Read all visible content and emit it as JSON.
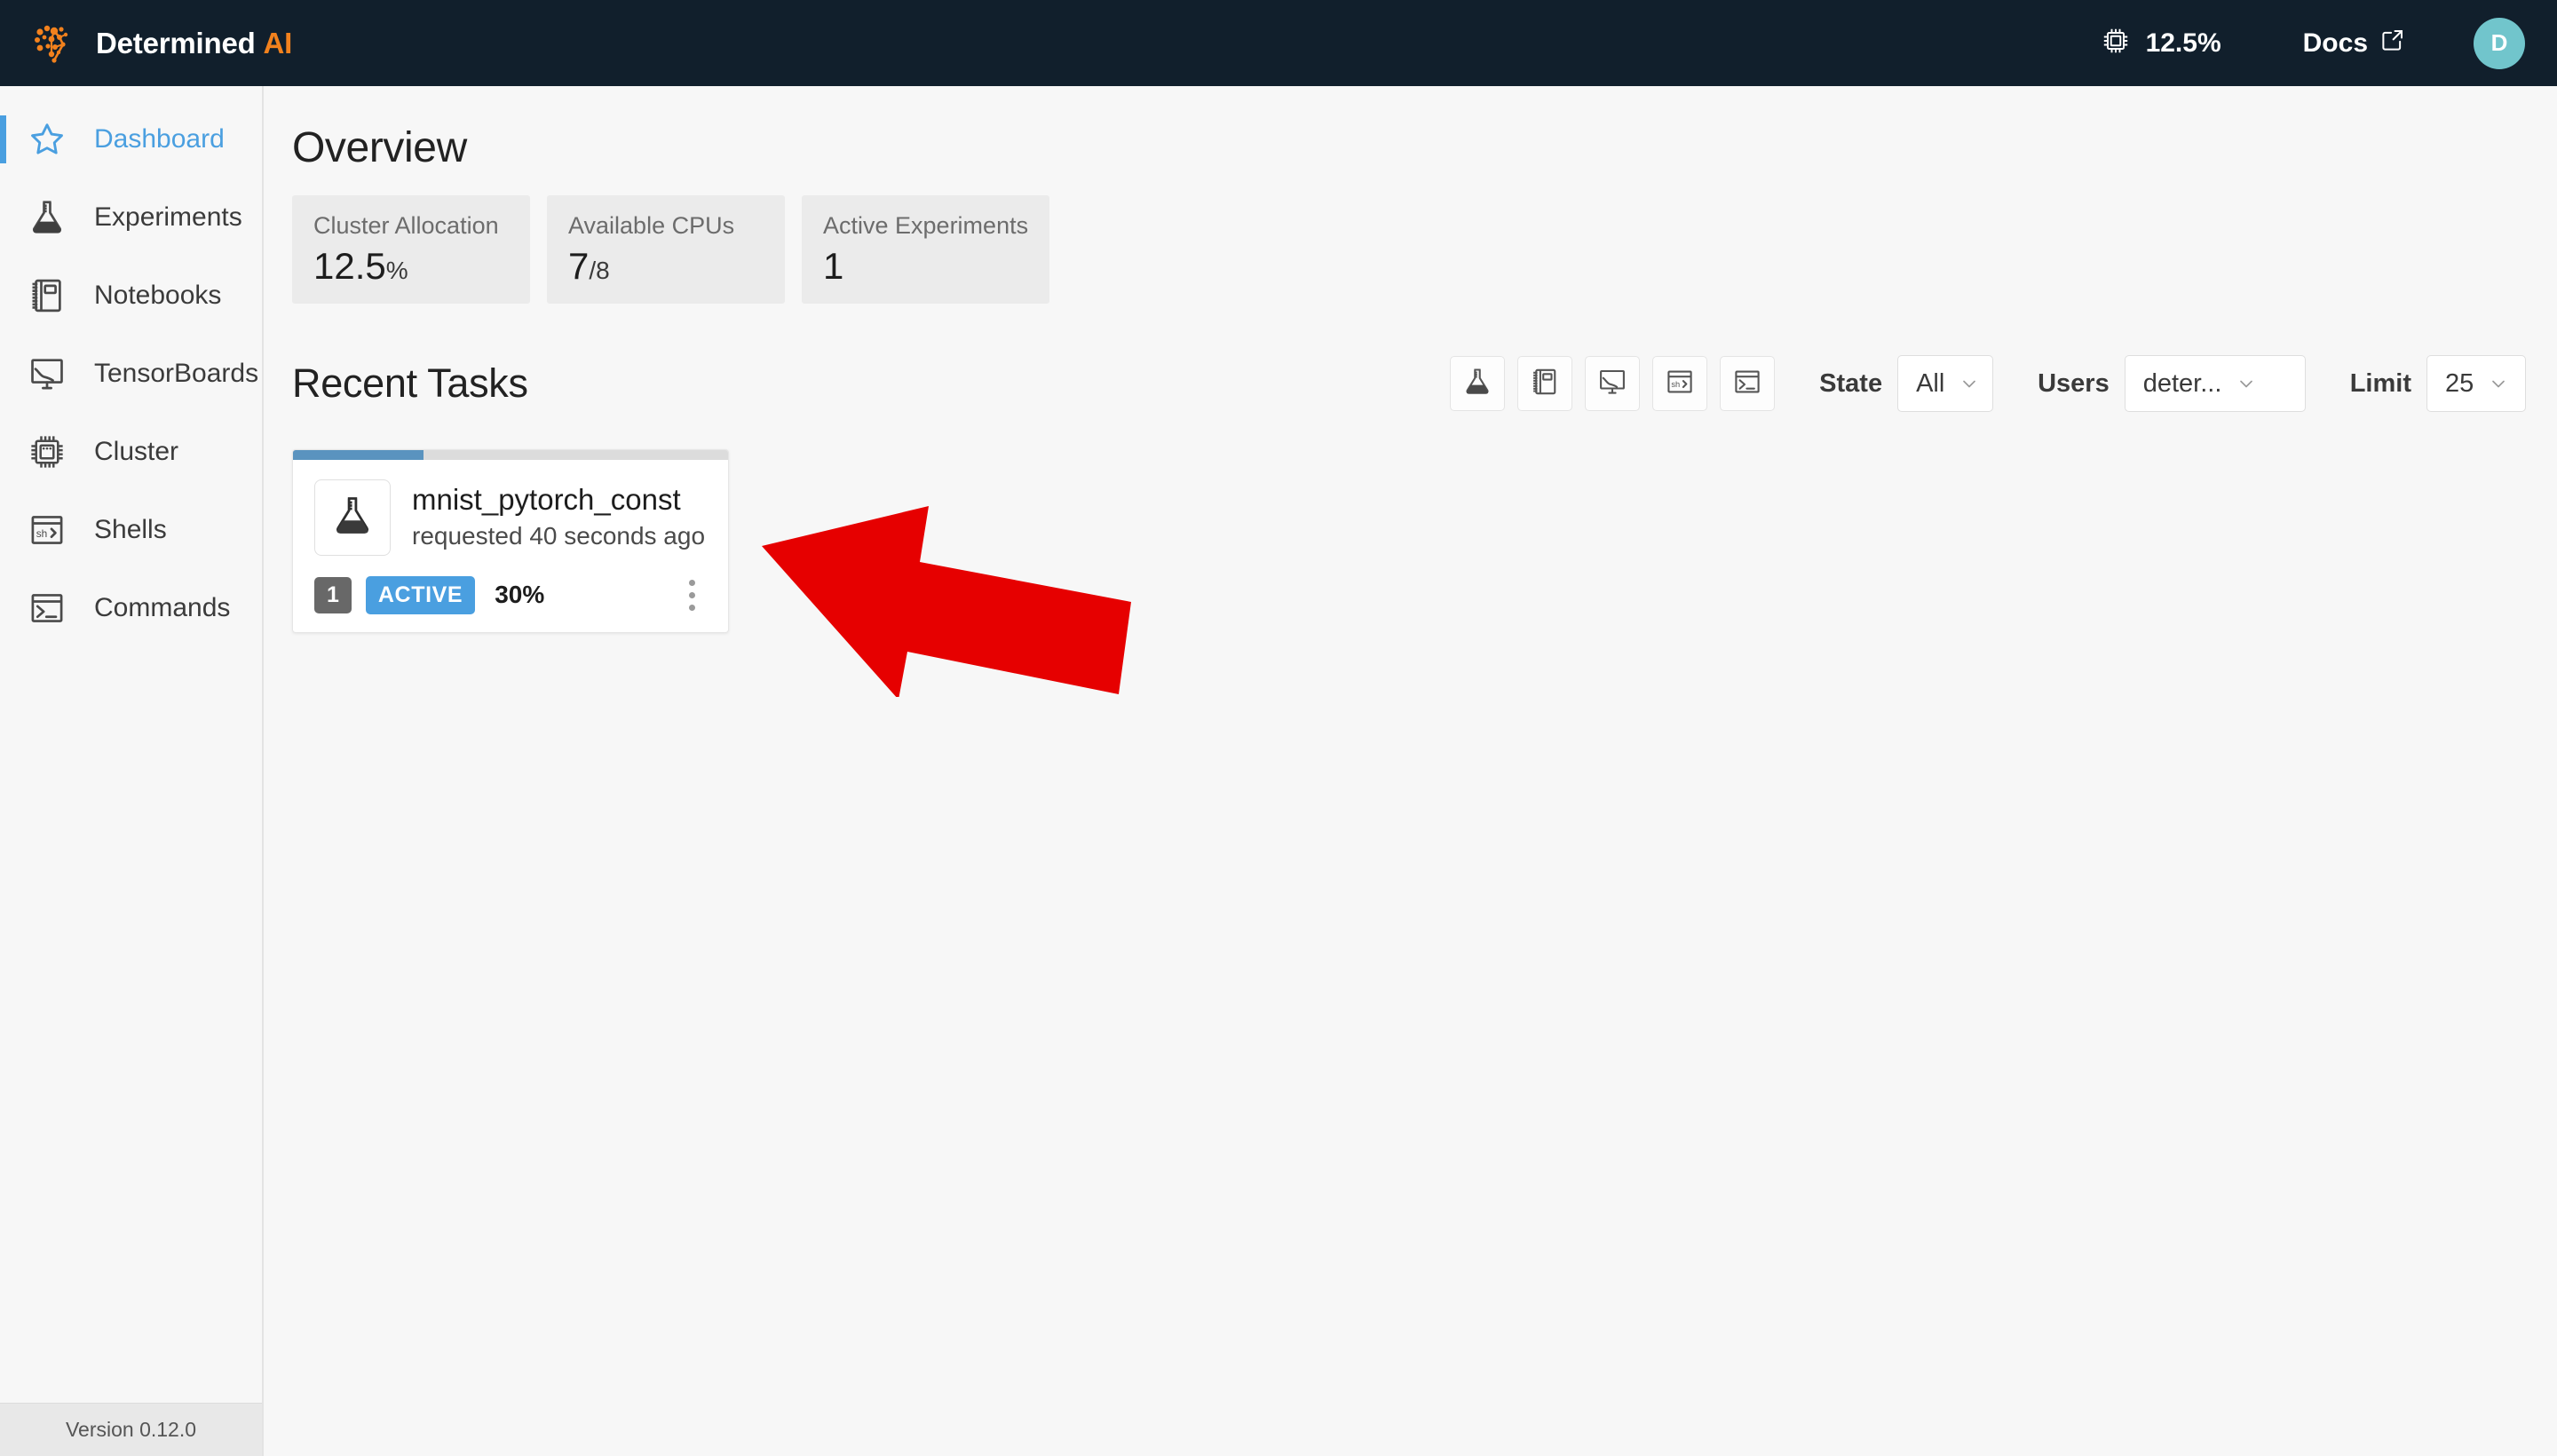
{
  "topnav": {
    "brand": {
      "name": "Determined",
      "accent": "AI",
      "logo_icon": "brain-network-icon",
      "accent_color": "#f2811d"
    },
    "cluster_usage": {
      "icon": "cpu-chip-icon",
      "value": "12.5%"
    },
    "docs": {
      "label": "Docs",
      "icon": "external-link-icon"
    },
    "avatar": {
      "initial": "D",
      "color": "#71c5cc"
    }
  },
  "sidebar": {
    "items": [
      {
        "label": "Dashboard",
        "icon": "star-icon",
        "active": true
      },
      {
        "label": "Experiments",
        "icon": "flask-icon",
        "active": false
      },
      {
        "label": "Notebooks",
        "icon": "notebook-icon",
        "active": false
      },
      {
        "label": "TensorBoards",
        "icon": "chart-board-icon",
        "active": false
      },
      {
        "label": "Cluster",
        "icon": "cpu-chip-icon",
        "active": false
      },
      {
        "label": "Shells",
        "icon": "shell-sh-icon",
        "active": false
      },
      {
        "label": "Commands",
        "icon": "terminal-icon",
        "active": false
      }
    ],
    "footer": {
      "version_label": "Version 0.12.0"
    }
  },
  "main": {
    "overview": {
      "title": "Overview",
      "stats": [
        {
          "label": "Cluster Allocation",
          "value": "12.5",
          "suffix": "%"
        },
        {
          "label": "Available CPUs",
          "value": "7",
          "suffix": "/8"
        },
        {
          "label": "Active Experiments",
          "value": "1",
          "suffix": ""
        }
      ]
    },
    "recent_tasks": {
      "title": "Recent Tasks",
      "filter_buttons": [
        {
          "icon": "flask-icon",
          "name": "filter-experiments"
        },
        {
          "icon": "notebook-icon",
          "name": "filter-notebooks"
        },
        {
          "icon": "chart-board-icon",
          "name": "filter-tensorboards"
        },
        {
          "icon": "shell-sh-icon",
          "name": "filter-shells"
        },
        {
          "icon": "terminal-icon",
          "name": "filter-commands"
        }
      ],
      "filters": {
        "state": {
          "label": "State",
          "value": "All"
        },
        "users": {
          "label": "Users",
          "value": "deter..."
        },
        "limit": {
          "label": "Limit",
          "value": "25"
        }
      },
      "cards": [
        {
          "icon": "flask-icon",
          "name": "mnist_pytorch_const",
          "subtitle": "requested 40 seconds ago",
          "count_badge": "1",
          "state_badge": "ACTIVE",
          "progress_label": "30%",
          "progress_pct": 30,
          "state_color": "#4a9fe0",
          "menu_icon": "kebab-menu-icon"
        }
      ]
    }
  },
  "annotation": {
    "shape": "left-arrow",
    "color": "#e60000"
  }
}
